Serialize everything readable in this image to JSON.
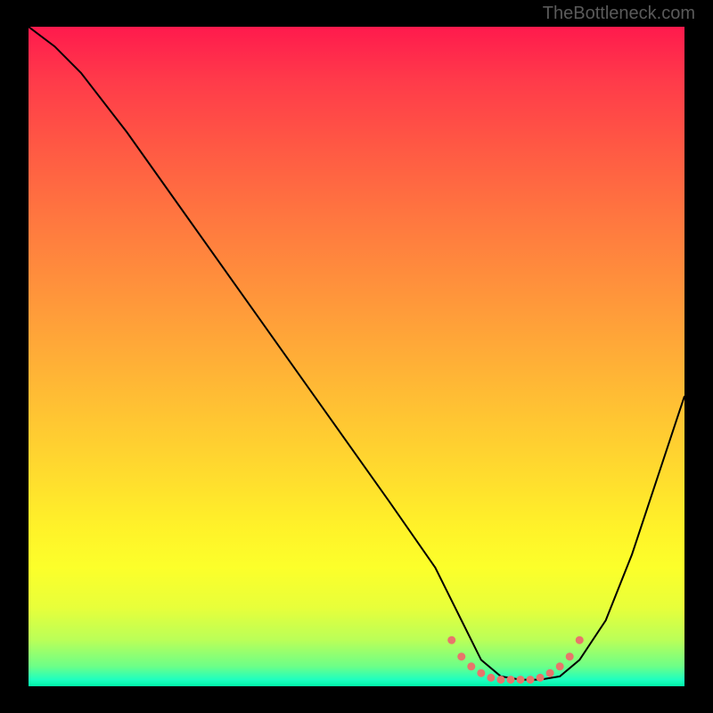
{
  "watermark": "TheBottleneck.com",
  "chart_data": {
    "type": "line",
    "note": "Axes are unlabeled and ticks are absent; values below are normalized 0–100 where y=0 is top of plot area and y=100 is bottom. Curve depicts a bottleneck-style dip: high on left, minimum plateau around x≈67–82, rising again on right.",
    "x": [
      0,
      4,
      8,
      15,
      25,
      35,
      45,
      55,
      62,
      66,
      69,
      72,
      75,
      78,
      81,
      84,
      88,
      92,
      96,
      100
    ],
    "y": [
      0,
      3,
      7,
      16,
      30,
      44,
      58,
      72,
      82,
      90,
      96,
      98.5,
      99,
      99,
      98.5,
      96,
      90,
      80,
      68,
      56
    ],
    "dotted_segment": {
      "x": [
        64.5,
        66,
        67.5,
        69,
        70.5,
        72,
        73.5,
        75,
        76.5,
        78,
        79.5,
        81,
        82.5,
        84
      ],
      "y": [
        93,
        95.5,
        97,
        98,
        98.7,
        99,
        99,
        99,
        99,
        98.7,
        98,
        97,
        95.5,
        93
      ]
    },
    "gradient_stops": [
      {
        "pos": 0,
        "color": "#ff1a4d"
      },
      {
        "pos": 50,
        "color": "#ffb035"
      },
      {
        "pos": 80,
        "color": "#fcff2a"
      },
      {
        "pos": 100,
        "color": "#00f5a8"
      }
    ],
    "xlim": [
      0,
      100
    ],
    "ylim": [
      0,
      100
    ]
  }
}
